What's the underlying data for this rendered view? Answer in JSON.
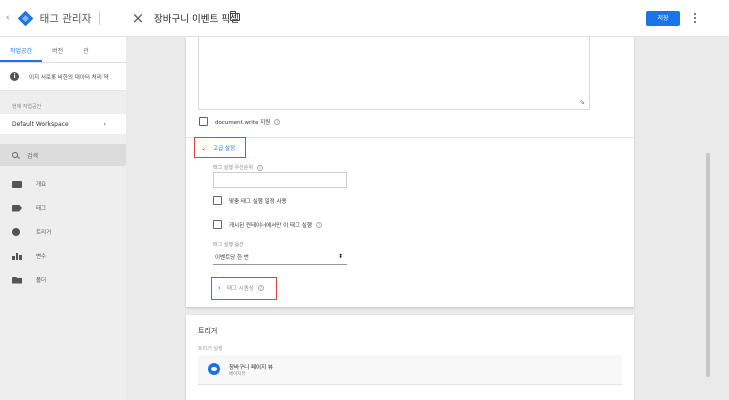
{
  "background_workspace": {
    "app_title": "태그 관리자",
    "tabs": [
      {
        "label": "작업공간",
        "active": true
      },
      {
        "label": "버전",
        "active": false
      },
      {
        "label": "관",
        "active": false
      }
    ],
    "notice": "이지 서로롯 비한의 대이터 처리 약",
    "workspace_label": "현재 작업공간",
    "workspace_name": "Default Workspace",
    "search_placeholder": "검색",
    "nav": [
      {
        "label": "개요",
        "icon": "briefcase-icon"
      },
      {
        "label": "태그",
        "icon": "tag-icon"
      },
      {
        "label": "트리거",
        "icon": "trigger-icon"
      },
      {
        "label": "변수",
        "icon": "variables-icon"
      },
      {
        "label": "폴더",
        "icon": "folder-icon"
      }
    ]
  },
  "panel": {
    "title": "장바구니 이벤트 픽셀",
    "save_label": "저장",
    "accent_color": "#1a73e8",
    "highlight_color": "#e04343"
  },
  "tag_config": {
    "docwrite_label": "document.write 지원",
    "docwrite_checked": false,
    "advanced_label": "고급 설정",
    "priority_label": "태그 실행 우선순위",
    "priority_value": "",
    "schedule_label": "맞춤 태그 실행 일정 사용",
    "schedule_checked": false,
    "onlyin_label": "게시된 컨테이너에서만 이 태그 실행",
    "onlyin_checked": false,
    "firing_label": "태그 실행 옵션",
    "firing_value": "이벤트당 한 번",
    "sequencing_label": "태그 시퀀싱"
  },
  "triggering": {
    "title": "트리거",
    "subtitle": "트리거 실행",
    "items": [
      {
        "name": "장바구니 페이지 뷰",
        "type": "페이지뷰",
        "icon": "eye-icon"
      }
    ]
  }
}
